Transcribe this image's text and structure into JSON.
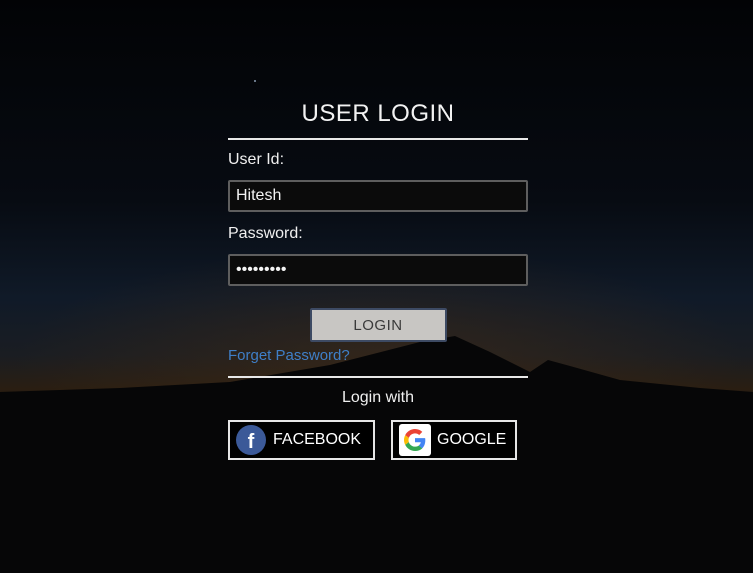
{
  "header": {
    "title": "USER LOGIN"
  },
  "form": {
    "user_label": "User Id:",
    "user_value": "Hitesh",
    "password_label": "Password:",
    "password_value": "123456789",
    "login_label": "LOGIN",
    "forgot_label": "Forget Password?"
  },
  "social": {
    "heading": "Login with",
    "facebook_label": "FACEBOOK",
    "google_label": "GOOGLE",
    "facebook_icon": "facebook-icon",
    "google_icon": "google-icon"
  },
  "colors": {
    "link": "#3f7fc8",
    "login_button_bg": "#c8c6c3",
    "facebook_blue": "#3b5998"
  }
}
